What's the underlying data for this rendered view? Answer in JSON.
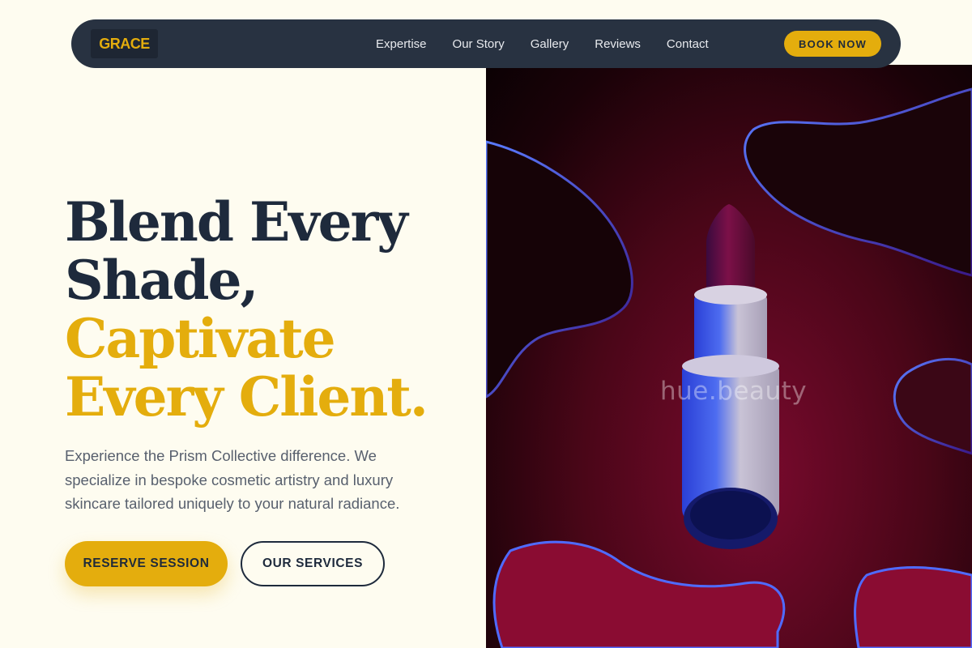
{
  "nav": {
    "logo": "GRACE",
    "links": [
      "Expertise",
      "Our Story",
      "Gallery",
      "Reviews",
      "Contact"
    ],
    "cta": "BOOK NOW"
  },
  "hero": {
    "headline_dark": [
      "Blend Every",
      "Shade,"
    ],
    "headline_gold": [
      "Captivate",
      "Every Client."
    ],
    "lede": "Experience the Prism Collective difference. We specialize in bespoke cosmetic artistry and luxury skincare tailored uniquely to your natural radiance.",
    "primary_cta": "RESERVE SESSION",
    "secondary_cta": "OUR SERVICES"
  },
  "image": {
    "watermark": "hue.beauty",
    "subject": "lipstick-on-crimson-liquid"
  },
  "colors": {
    "background": "#fefcf0",
    "navy": "#283241",
    "gold": "#e4ad0d",
    "crimson": "#7a0a2e"
  }
}
